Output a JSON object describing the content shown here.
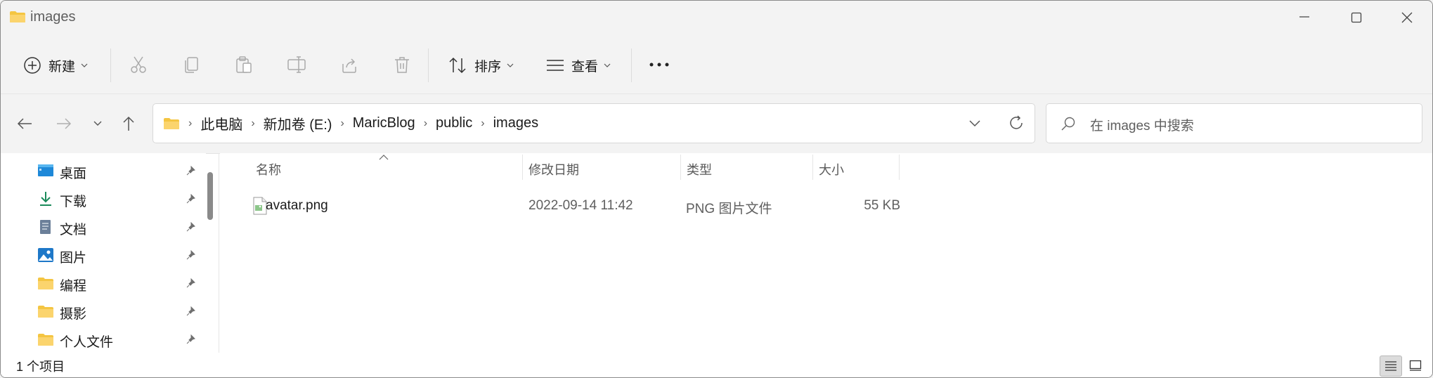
{
  "window": {
    "title": "images"
  },
  "toolbar": {
    "new_label": "新建",
    "sort_label": "排序",
    "view_label": "查看",
    "icons": [
      "cut-icon",
      "copy-icon",
      "paste-icon",
      "rename-icon",
      "share-icon",
      "delete-icon",
      "more-icon"
    ]
  },
  "breadcrumb": [
    "此电脑",
    "新加卷 (E:)",
    "MaricBlog",
    "public",
    "images"
  ],
  "search": {
    "placeholder": "在 images 中搜索"
  },
  "sidebar": {
    "items": [
      {
        "label": "桌面",
        "icon": "desktop-icon"
      },
      {
        "label": "下载",
        "icon": "download-icon"
      },
      {
        "label": "文档",
        "icon": "document-icon"
      },
      {
        "label": "图片",
        "icon": "pictures-icon"
      },
      {
        "label": "编程",
        "icon": "folder-icon"
      },
      {
        "label": "摄影",
        "icon": "folder-icon"
      },
      {
        "label": "个人文件",
        "icon": "folder-icon"
      }
    ]
  },
  "columns": {
    "name": "名称",
    "modified": "修改日期",
    "type": "类型",
    "size": "大小"
  },
  "files": [
    {
      "name": "avatar.png",
      "modified": "2022-09-14 11:42",
      "type": "PNG 图片文件",
      "size": "55 KB"
    }
  ],
  "status": {
    "count": "1 个项目"
  },
  "colors": {
    "folder": "#f4c542",
    "accent": "#0067c0"
  }
}
